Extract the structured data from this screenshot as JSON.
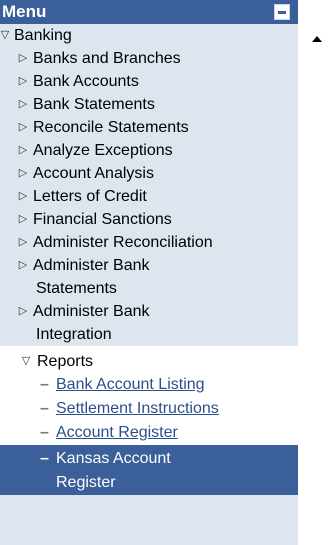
{
  "menu": {
    "title": "Menu",
    "root": "Banking",
    "items": [
      "Banks and Branches",
      "Bank Accounts",
      "Bank Statements",
      "Reconcile Statements",
      "Analyze Exceptions",
      "Account Analysis",
      "Letters of Credit",
      "Financial Sanctions",
      "Administer Reconciliation"
    ],
    "wrapped_items": [
      {
        "line1": "Administer Bank",
        "line2": "Statements"
      },
      {
        "line1": "Administer Bank",
        "line2": "Integration"
      }
    ],
    "reports": {
      "label": "Reports",
      "links": [
        "Bank Account Listing",
        "Settlement Instructions",
        "Account Register"
      ],
      "selected_line1": "Kansas Account",
      "selected_line2": "Register"
    }
  }
}
